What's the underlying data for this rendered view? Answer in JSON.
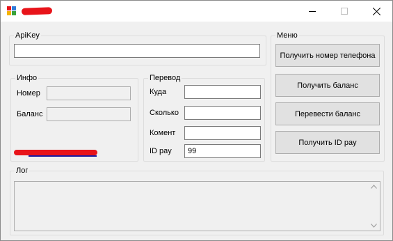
{
  "window": {
    "title": "",
    "controls": [
      "minimize",
      "maximize",
      "close"
    ]
  },
  "apikey": {
    "group_title": "ApiKey",
    "value": ""
  },
  "info": {
    "group_title": "Инфо",
    "number_label": "Номер",
    "number_value": "",
    "balance_label": "Баланс",
    "balance_value": ""
  },
  "transfer": {
    "group_title": "Перевод",
    "to_label": "Куда",
    "to_value": "",
    "amount_label": "Сколько",
    "amount_value": "",
    "comment_label": "Комент",
    "comment_value": "",
    "idpay_label": "ID pay",
    "idpay_value": "99"
  },
  "menu": {
    "group_title": "Меню",
    "buttons": [
      "Получить номер телефона",
      "Получить баланс",
      "Перевести баланс",
      "Получить ID pay"
    ]
  },
  "log": {
    "group_title": "Лог",
    "value": ""
  },
  "colors": {
    "redaction": "#e8141a",
    "window_bg": "#f0f0f0",
    "button_bg": "#e1e1e1"
  }
}
